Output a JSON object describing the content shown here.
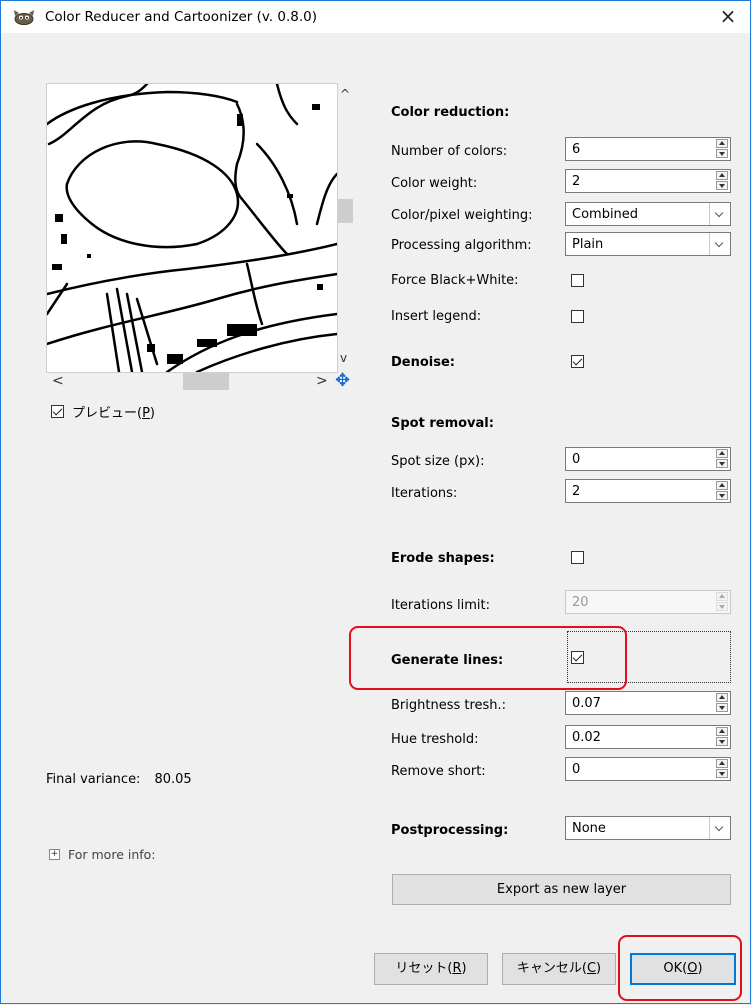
{
  "window": {
    "title": "Color Reducer and Cartoonizer (v. 0.8.0)",
    "close_label": "×"
  },
  "preview": {
    "checkbox_label": "プレビュー(",
    "checkbox_mnemonic": "P",
    "checkbox_label_end": ")",
    "checked": true,
    "scroll_up": "^",
    "scroll_down": "v",
    "scroll_left": "<",
    "scroll_right": ">"
  },
  "left": {
    "final_variance_label": "Final variance:",
    "final_variance_value": "80.05",
    "more_info_label": "For more info:",
    "expander": "+"
  },
  "color_reduction": {
    "heading": "Color reduction:",
    "number_of_colors_label": "Number of colors:",
    "number_of_colors_value": "6",
    "color_weight_label": "Color weight:",
    "color_weight_value": "2",
    "weighting_label": "Color/pixel weighting:",
    "weighting_value": "Combined",
    "algorithm_label": "Processing algorithm:",
    "algorithm_value": "Plain",
    "force_bw_label": "Force Black+White:",
    "force_bw_checked": false,
    "legend_label": "Insert legend:",
    "legend_checked": false
  },
  "denoise": {
    "label": "Denoise:",
    "checked": true
  },
  "spot_removal": {
    "heading": "Spot removal:",
    "spot_size_label": "Spot size (px):",
    "spot_size_value": "0",
    "iterations_label": "Iterations:",
    "iterations_value": "2"
  },
  "erode": {
    "label": "Erode shapes:",
    "checked": false,
    "iter_limit_label": "Iterations limit:",
    "iter_limit_value": "20"
  },
  "lines": {
    "label": "Generate lines:",
    "checked": true,
    "brightness_label": "Brightness tresh.:",
    "brightness_value": "0.07",
    "hue_label": "Hue treshold:",
    "hue_value": "0.02",
    "remove_short_label": "Remove short:",
    "remove_short_value": "0"
  },
  "post": {
    "label": "Postprocessing:",
    "value": "None"
  },
  "buttons": {
    "export": "Export as new layer",
    "reset": "リセット(",
    "reset_key": "R",
    "cancel": "キャンセル(",
    "cancel_key": "C",
    "ok": "OK(",
    "ok_key": "O",
    "close_paren": ")"
  },
  "colors": {
    "highlight": "#e0101b",
    "window_border": "#1e7ad6",
    "accent": "#1b6ac9"
  }
}
